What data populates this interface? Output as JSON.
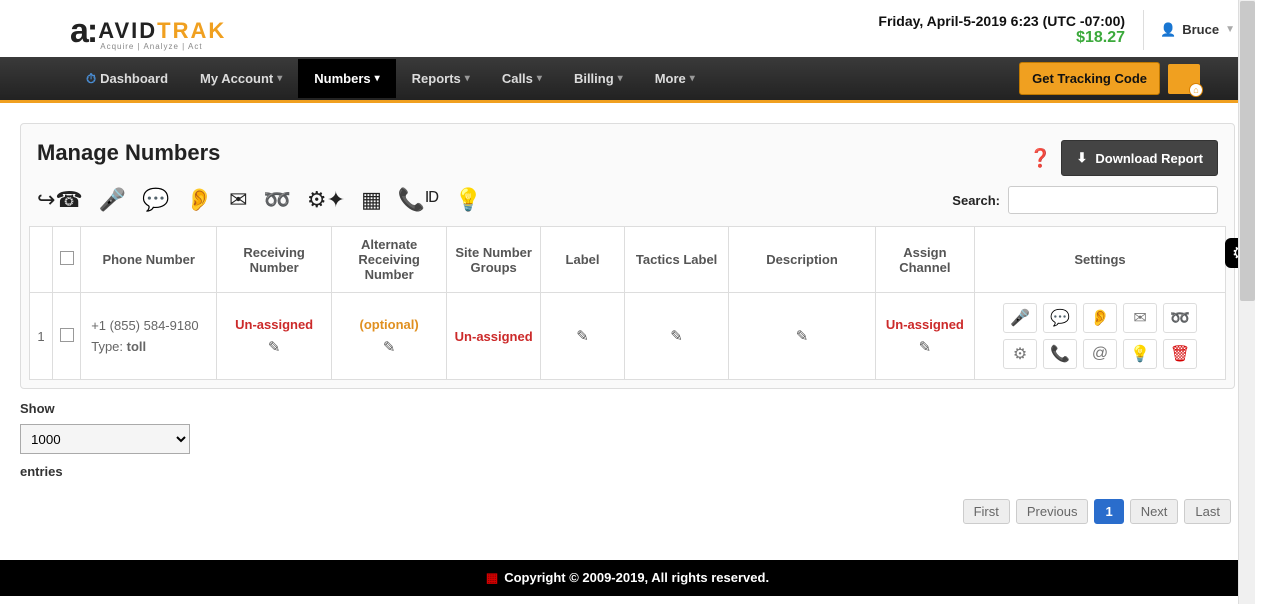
{
  "header": {
    "logo_avid": "AVID",
    "logo_trak": "TRAK",
    "logo_sub": "Acquire | Analyze | Act",
    "datetime": "Friday, April-5-2019 6:23 (UTC -07:00)",
    "balance": "$18.27",
    "user_name": "Bruce"
  },
  "nav": {
    "items": [
      {
        "label": "Dashboard"
      },
      {
        "label": "My Account"
      },
      {
        "label": "Numbers"
      },
      {
        "label": "Reports"
      },
      {
        "label": "Calls"
      },
      {
        "label": "Billing"
      },
      {
        "label": "More"
      }
    ],
    "tracking_btn": "Get Tracking Code"
  },
  "panel": {
    "title": "Manage Numbers",
    "download": "Download Report",
    "search_label": "Search:"
  },
  "table": {
    "headers": [
      "",
      "",
      "Phone Number",
      "Receiving Number",
      "Alternate Receiving Number",
      "Site Number Groups",
      "Label",
      "Tactics Label",
      "Description",
      "Assign Channel",
      "Settings"
    ],
    "row": {
      "idx": "1",
      "phone": "+1 (855) 584-9180",
      "type_label": "Type:",
      "type_value": "toll",
      "receiving": "Un-assigned",
      "alternate": "(optional)",
      "site_groups": "Un-assigned",
      "assign_channel": "Un-assigned"
    }
  },
  "controls": {
    "show": "Show",
    "show_value": "1000",
    "entries": "entries",
    "pagination": {
      "first": "First",
      "prev": "Previous",
      "page": "1",
      "next": "Next",
      "last": "Last"
    }
  },
  "footer": "Copyright © 2009-2019, All rights reserved."
}
